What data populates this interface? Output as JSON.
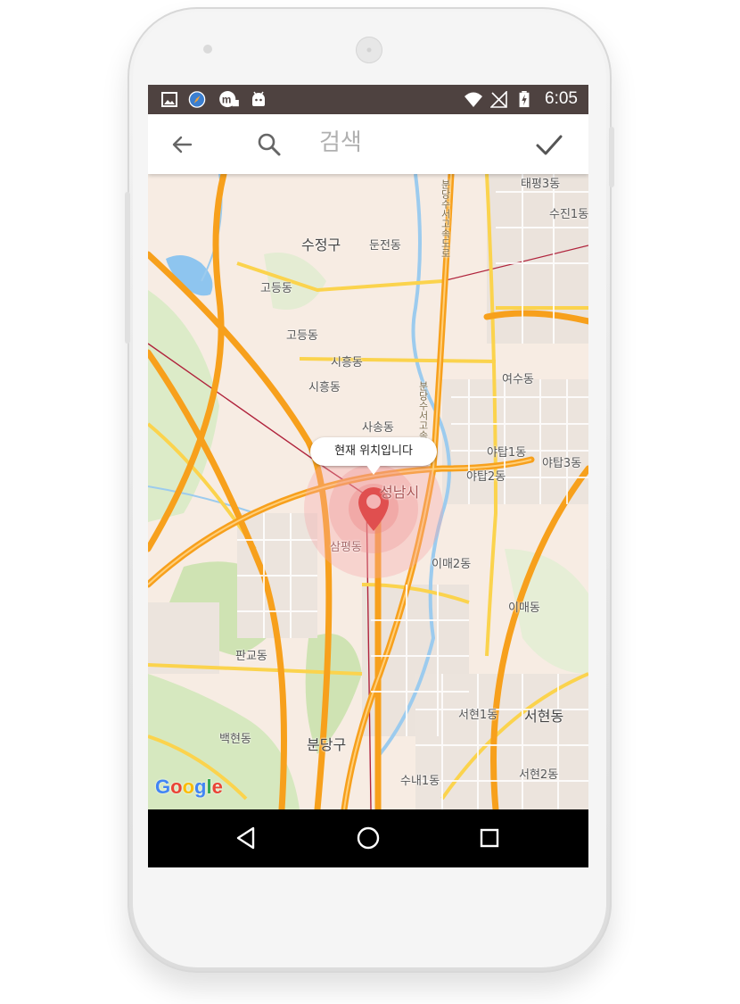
{
  "status_bar": {
    "time": "6:05",
    "left_icons": [
      "image-icon",
      "compass-icon",
      "m-app-icon",
      "android-debug-icon"
    ],
    "right_icons": [
      "wifi-icon",
      "no-signal-icon",
      "battery-charging-icon"
    ]
  },
  "toolbar": {
    "search_placeholder": "검색",
    "back_icon": "arrow-back-icon",
    "search_icon": "search-icon",
    "confirm_icon": "check-icon"
  },
  "map": {
    "callout_text": "현재 위치입니다",
    "attribution": "Google",
    "labels": [
      {
        "text": "태평3동"
      },
      {
        "text": "수진1동"
      },
      {
        "text": "수정구"
      },
      {
        "text": "둔전동"
      },
      {
        "text": "고등동"
      },
      {
        "text": "고등동"
      },
      {
        "text": "시흥동"
      },
      {
        "text": "시흥동"
      },
      {
        "text": "여수동"
      },
      {
        "text": "사송동"
      },
      {
        "text": "야탑1동"
      },
      {
        "text": "야탑3동"
      },
      {
        "text": "야탑2동"
      },
      {
        "text": "성남시"
      },
      {
        "text": "삼평동"
      },
      {
        "text": "이매2동"
      },
      {
        "text": "이매동"
      },
      {
        "text": "판교동"
      },
      {
        "text": "서현1동"
      },
      {
        "text": "서현동"
      },
      {
        "text": "백현동"
      },
      {
        "text": "분당구"
      },
      {
        "text": "수내1동"
      },
      {
        "text": "서현2동"
      }
    ],
    "road_labels": [
      "분당수서고속도로",
      "분당수서고속도로"
    ]
  },
  "nav_bar": {
    "icons": [
      "back-triangle-icon",
      "home-circle-icon",
      "recents-square-icon"
    ]
  },
  "colors": {
    "status_bar": "#4e4240",
    "highway": "#f7a01c",
    "arterial": "#fbd34d",
    "river": "#8ec5ef",
    "park": "#cfe3b3",
    "marker": "#e04f4f",
    "accuracy_circle": "#f6a6a6"
  }
}
